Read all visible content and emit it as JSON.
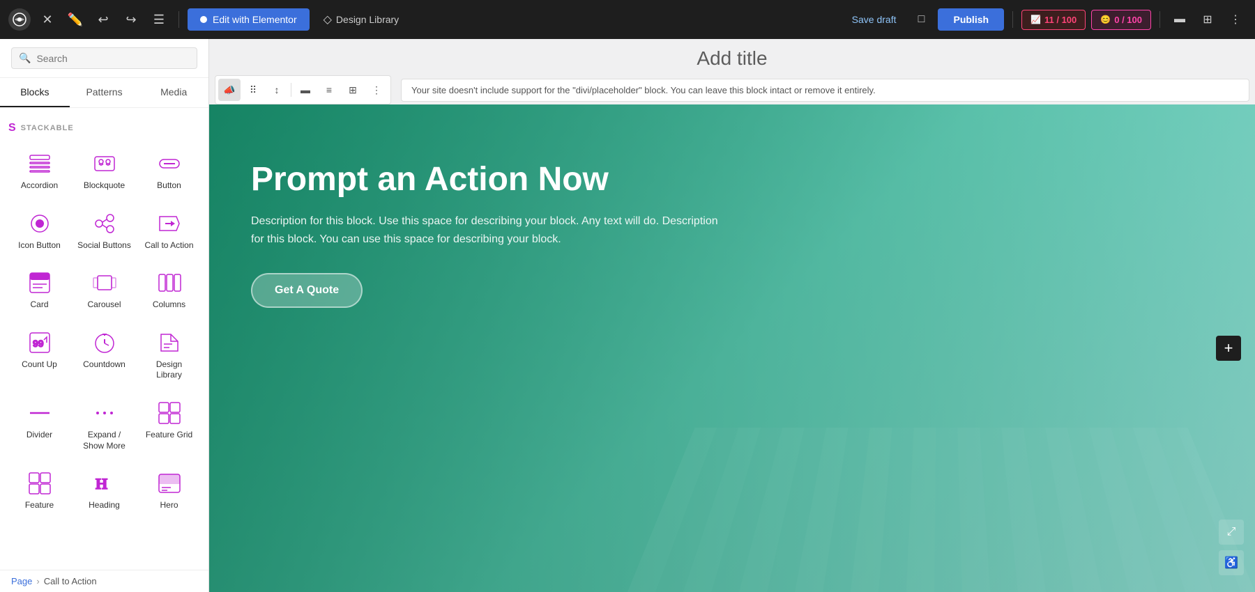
{
  "topbar": {
    "edit_label": "Edit with Elementor",
    "design_library_label": "Design Library",
    "save_draft_label": "Save draft",
    "publish_label": "Publish",
    "score1": "11 / 100",
    "score2": "0 / 100"
  },
  "sidebar": {
    "search_placeholder": "Search",
    "tabs": [
      "Blocks",
      "Patterns",
      "Media"
    ],
    "active_tab": 0,
    "section_label": "STACKABLE",
    "blocks": [
      {
        "id": "accordion",
        "label": "Accordion",
        "icon": "accordion"
      },
      {
        "id": "blockquote",
        "label": "Blockquote",
        "icon": "blockquote"
      },
      {
        "id": "button",
        "label": "Button",
        "icon": "button"
      },
      {
        "id": "icon-button",
        "label": "Icon Button",
        "icon": "icon-button"
      },
      {
        "id": "social-buttons",
        "label": "Social Buttons",
        "icon": "social-buttons"
      },
      {
        "id": "call-to-action",
        "label": "Call to Action",
        "icon": "call-to-action"
      },
      {
        "id": "card",
        "label": "Card",
        "icon": "card"
      },
      {
        "id": "carousel",
        "label": "Carousel",
        "icon": "carousel"
      },
      {
        "id": "columns",
        "label": "Columns",
        "icon": "columns"
      },
      {
        "id": "count-up",
        "label": "Count Up",
        "icon": "count-up"
      },
      {
        "id": "countdown",
        "label": "Countdown",
        "icon": "countdown"
      },
      {
        "id": "design-library",
        "label": "Design Library",
        "icon": "design-library"
      },
      {
        "id": "divider",
        "label": "Divider",
        "icon": "divider"
      },
      {
        "id": "expand-show-more",
        "label": "Expand / Show More",
        "icon": "expand-show-more"
      },
      {
        "id": "feature-grid",
        "label": "Feature Grid",
        "icon": "feature-grid"
      },
      {
        "id": "feature",
        "label": "Feature",
        "icon": "feature"
      },
      {
        "id": "heading",
        "label": "Heading",
        "icon": "heading"
      },
      {
        "id": "hero",
        "label": "Hero",
        "icon": "hero"
      }
    ]
  },
  "breadcrumb": {
    "items": [
      "Page",
      "Call to Action"
    ]
  },
  "canvas": {
    "title_placeholder": "Add title",
    "warning_message": "Your site doesn't include support for the \"divi/placeholder\" block. You can leave this block intact or remove it entirely.",
    "hero": {
      "title": "Prompt an Action Now",
      "description": "Description for this block. Use this space for describing your block. Any text will do. Description for this block. You can use this space for describing your block.",
      "button_label": "Get A Quote"
    }
  }
}
